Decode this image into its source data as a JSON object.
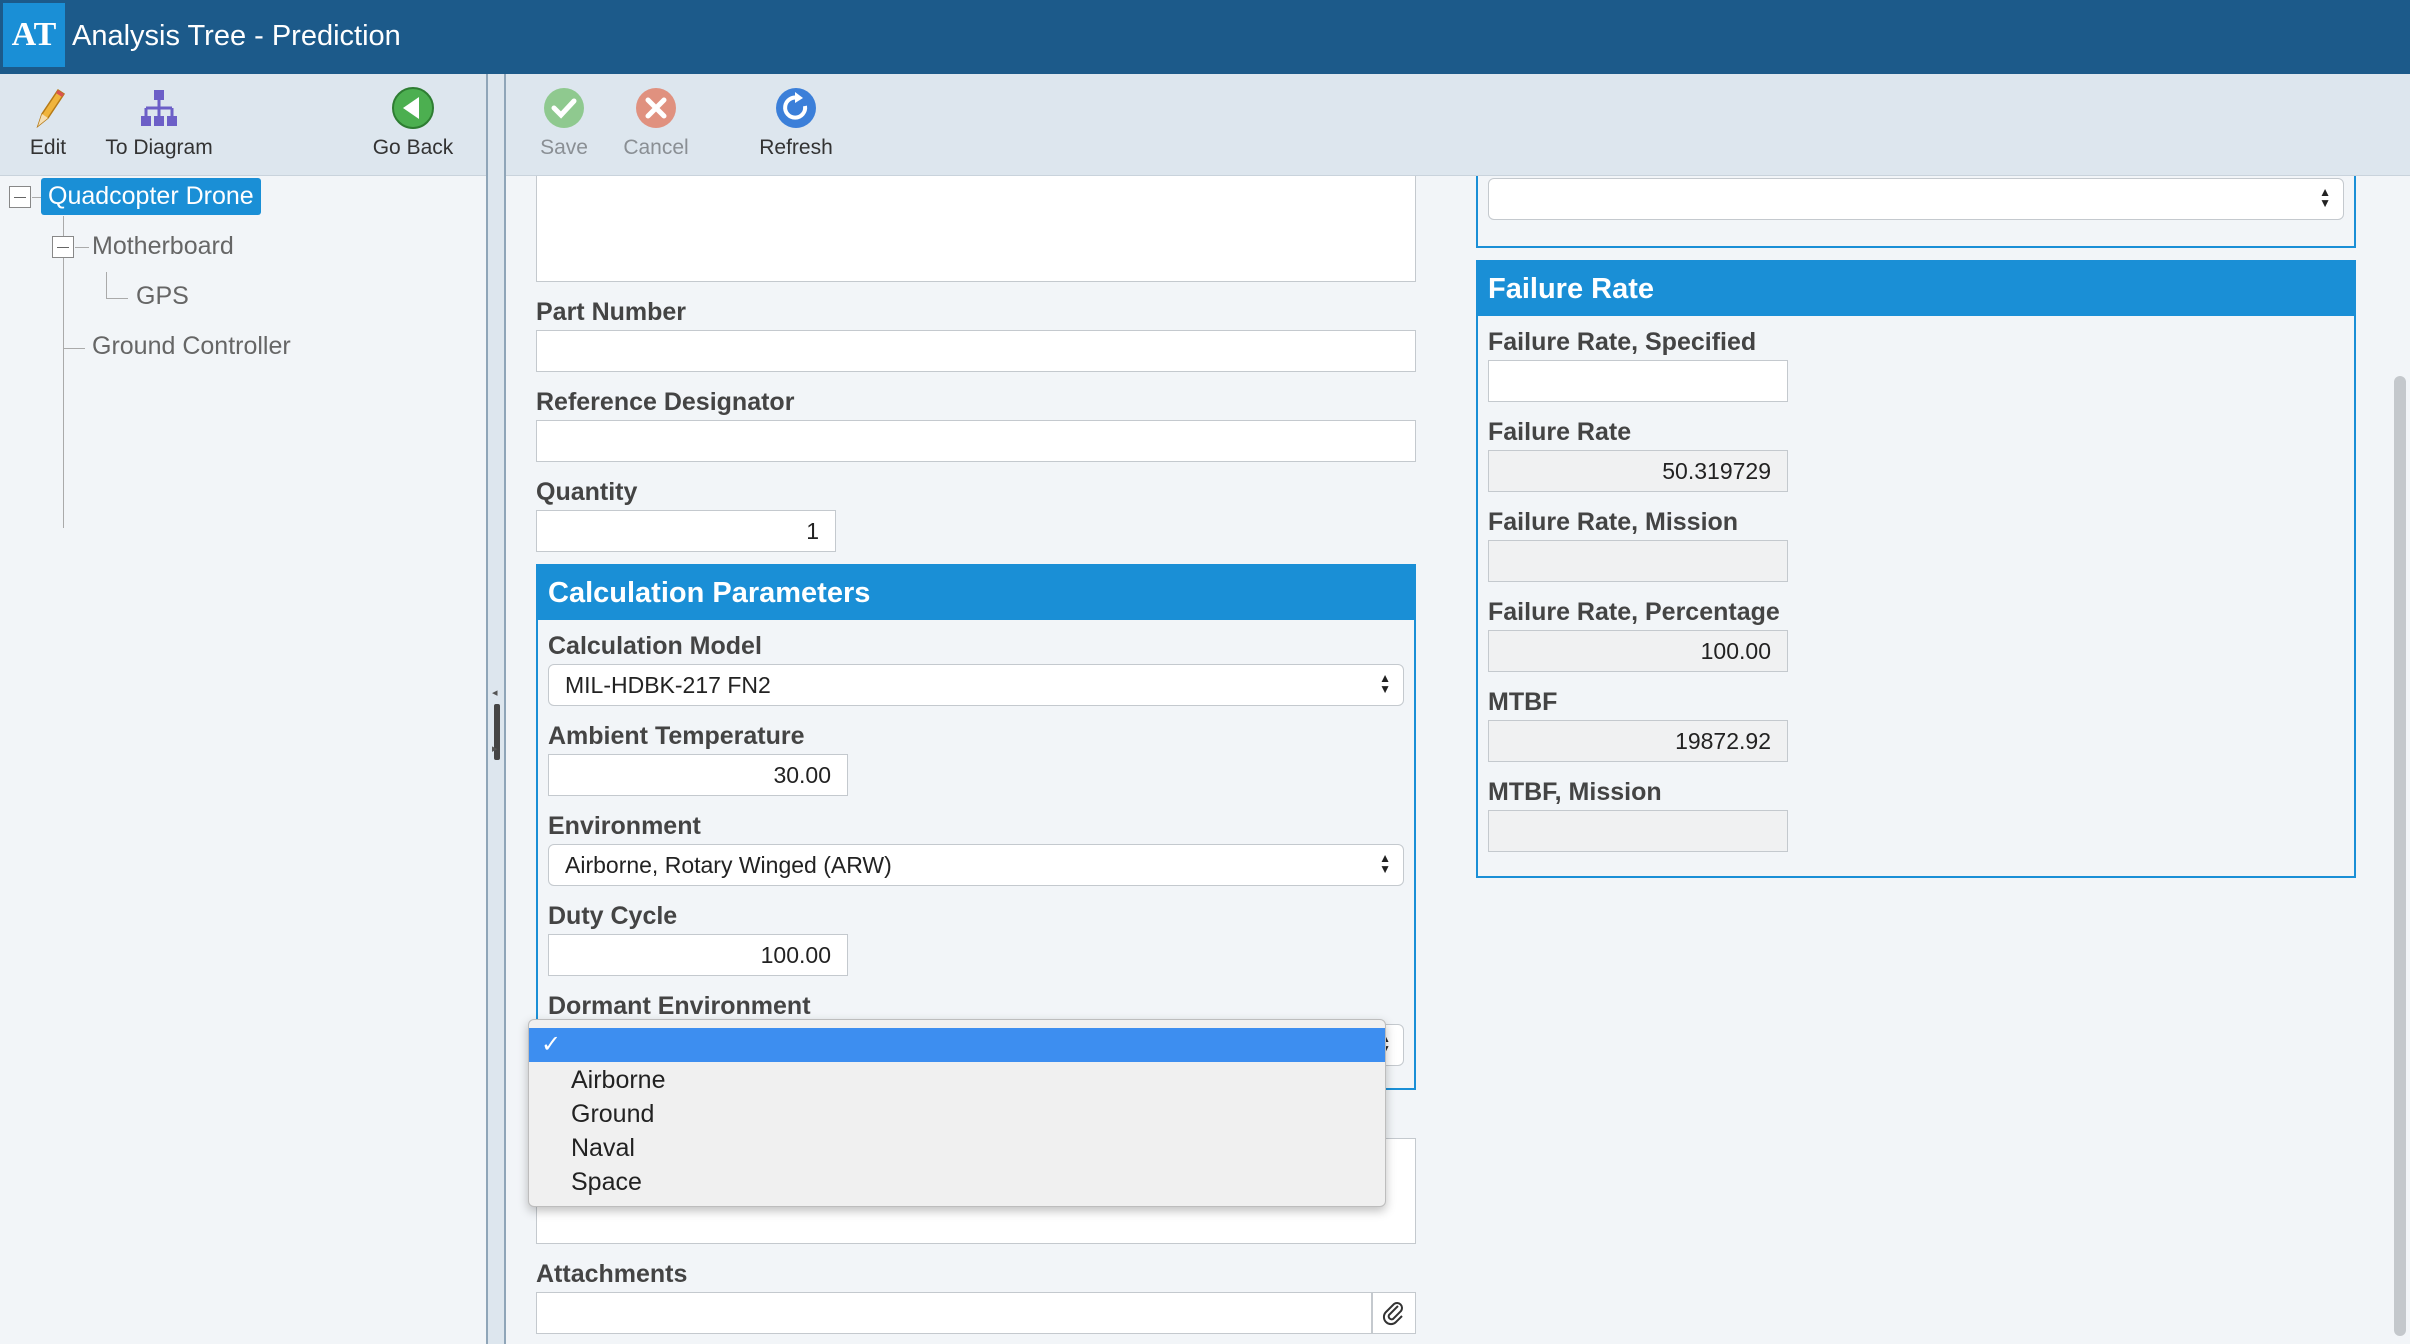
{
  "app": {
    "logo": "AT",
    "title": "Analysis Tree - Prediction"
  },
  "left_toolbar": {
    "edit": "Edit",
    "to_diagram": "To Diagram",
    "go_back": "Go Back"
  },
  "right_toolbar": {
    "save": "Save",
    "cancel": "Cancel",
    "refresh": "Refresh"
  },
  "tree": [
    {
      "label": "Quadcopter Drone",
      "selected": true
    },
    {
      "label": "Motherboard"
    },
    {
      "label": "GPS"
    },
    {
      "label": "Ground Controller"
    }
  ],
  "form": {
    "part_number_label": "Part Number",
    "part_number_value": "",
    "ref_designator_label": "Reference Designator",
    "ref_designator_value": "",
    "quantity_label": "Quantity",
    "quantity_value": "1",
    "attachments_label": "Attachments",
    "attachments_value": ""
  },
  "calc_params": {
    "title": "Calculation Parameters",
    "model_label": "Calculation Model",
    "model_value": "MIL-HDBK-217 FN2",
    "ambient_label": "Ambient Temperature",
    "ambient_value": "30.00",
    "environment_label": "Environment",
    "environment_value": "Airborne, Rotary Winged (ARW)",
    "duty_label": "Duty Cycle",
    "duty_value": "100.00",
    "dormant_label": "Dormant Environment",
    "dormant_value": ""
  },
  "dormant_dropdown": {
    "selected_mark": "✓",
    "options": [
      "Airborne",
      "Ground",
      "Naval",
      "Space"
    ]
  },
  "calc_method": {
    "value": ""
  },
  "failure_rate": {
    "title": "Failure Rate",
    "specified_label": "Failure Rate, Specified",
    "specified_value": "",
    "rate_label": "Failure Rate",
    "rate_value": "50.319729",
    "mission_label": "Failure Rate, Mission",
    "mission_value": "",
    "percentage_label": "Failure Rate, Percentage",
    "percentage_value": "100.00",
    "mtbf_label": "MTBF",
    "mtbf_value": "19872.92",
    "mtbf_mission_label": "MTBF, Mission",
    "mtbf_mission_value": ""
  },
  "colors": {
    "titlebar": "#1c5a8a",
    "accent": "#1a8fd6",
    "toolbar": "#dde6ee",
    "dropdown_highlight": "#3d8ef0"
  }
}
